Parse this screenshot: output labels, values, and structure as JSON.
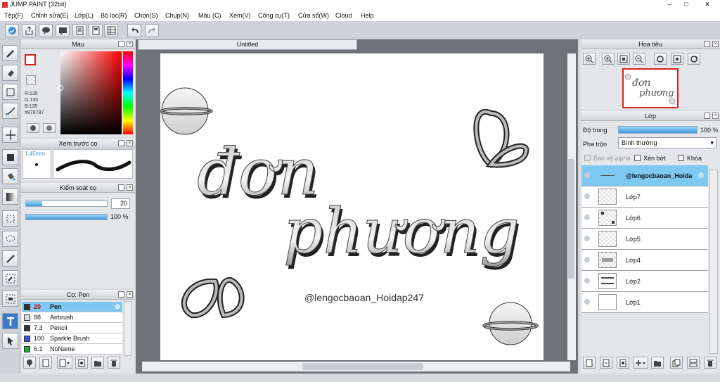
{
  "window": {
    "title": "JUMP PAINT (32bit)"
  },
  "menu": [
    "Tệp(F)",
    "Chỉnh sửa(E)",
    "Lớp(L)",
    "Bộ lọc(R)",
    "Chọn(S)",
    "Chụp(N)",
    "Màu (C)",
    "Xem(V)",
    "Công cụ(T)",
    "Cửa sổ(W)",
    "Cloud",
    "Help"
  ],
  "color_panel": {
    "title": "Màu",
    "r": "R:135",
    "g": "G:135",
    "b": "B:135",
    "hex": "#878787",
    "current": "#878787"
  },
  "brush_preview": {
    "title": "Xem trước cọ",
    "size": "1.45mm"
  },
  "brush_control": {
    "title": "Kiểm soát cọ",
    "size_value": "20",
    "opacity_value": "100 %",
    "size_fraction": 0.2,
    "opacity_fraction": 1.0
  },
  "brush_list": {
    "title": "Cọ: Pen",
    "items": [
      {
        "size": "20",
        "name": "Pen",
        "color": "#333333"
      },
      {
        "size": "88",
        "name": "Airbrush",
        "color": "#dddddd"
      },
      {
        "size": "7.3",
        "name": "Pencil",
        "color": "#333333"
      },
      {
        "size": "100",
        "name": "Sparkle Brush",
        "color": "#3a4fd4"
      },
      {
        "size": "6.1",
        "name": "NoName",
        "color": "#2aa53a"
      }
    ]
  },
  "document": {
    "tab": "Untitled"
  },
  "artwork": {
    "watermark": "@lengocbaoan_Hoidap247",
    "line1": "đơn",
    "line2": "phương"
  },
  "navigator": {
    "title": "Hoa tiêu"
  },
  "layers_panel": {
    "title": "Lớp",
    "opacity_label": "Độ trong",
    "opacity_value": "100 %",
    "opacity_fraction": 1.0,
    "blend_label": "Pha trộn",
    "blend_value": "Bình thường",
    "protect_alpha": "Bảo vệ alpha",
    "clipping": "Xén bớt",
    "lock": "Khóa",
    "layers": [
      {
        "name": "@lengocbaoan_Hoida",
        "selected": true
      },
      {
        "name": "Lớp7",
        "selected": false
      },
      {
        "name": "Lớp6",
        "selected": false
      },
      {
        "name": "Lớp5",
        "selected": false
      },
      {
        "name": "Lớp4",
        "selected": false
      },
      {
        "name": "Lớp2",
        "selected": false
      },
      {
        "name": "Lớp1",
        "selected": false
      }
    ]
  },
  "colors": {
    "accent": "#3d9de0",
    "selection": "#7ec8f2",
    "workspace": "#6e7277"
  }
}
